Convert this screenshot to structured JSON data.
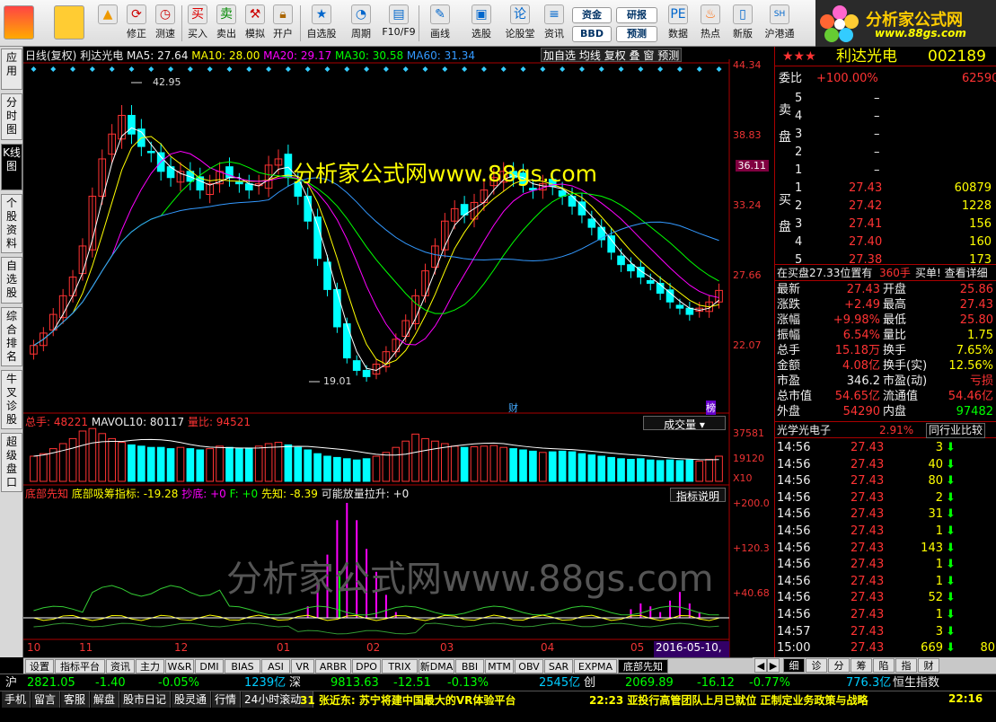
{
  "toolbar": {
    "items": [
      "修正",
      "测速",
      "买入",
      "卖出",
      "模拟",
      "开户",
      "自选股",
      "周期",
      "F10/F9",
      "画线",
      "选股",
      "论股堂",
      "资讯",
      "数据",
      "热点",
      "新版",
      "沪港通"
    ],
    "fund_label": "资金",
    "bbd_label": "BBD",
    "research_label": "研报",
    "forecast_label": "预测"
  },
  "logo": {
    "title": "分析家公式网",
    "url": "www.88gs.com"
  },
  "left_tabs": [
    "应用",
    "分时图",
    "K线图",
    "个股资料",
    "自选股",
    "综合排名",
    "牛叉诊股",
    "超级盘口"
  ],
  "chart_header": {
    "period": "日线(复权)",
    "stock": "利达光电",
    "ma5": "MA5: 27.64",
    "ma10": "MA10: 28.00",
    "ma20": "MA20: 29.17",
    "ma30": "MA30: 30.58",
    "ma60": "MA60: 31.34",
    "buttons": [
      "加自选",
      "均线",
      "复权",
      "叠",
      "窗",
      "预测"
    ]
  },
  "price_axis": [
    "44.34",
    "38.83",
    "33.24",
    "27.66",
    "22.07"
  ],
  "current_price_tag": "36.11",
  "annotations": {
    "high": "42.95",
    "low": "19.01",
    "cai": "财",
    "bang": "榜"
  },
  "watermark_top": "分析家公式网www.88gs.com",
  "watermark_bottom": "分析家公式网www.88gs.com",
  "volume_header": {
    "total": "总手: 48221",
    "mavol": "MAVOL10: 80117",
    "ratio": "量比: 94521",
    "dropdown": "成交量"
  },
  "volume_axis": [
    "37581",
    "19120",
    "X10"
  ],
  "indicator_header": {
    "name": "底部先知",
    "val1": "底部吸筹指标: -19.28",
    "val2": "抄底: +0",
    "val3": "F: +0",
    "val4": "先知: -8.39",
    "val5": "可能放量拉升: +0",
    "help": "指标说明"
  },
  "indicator_axis": [
    "+200.0",
    "+120.3",
    "+40.68"
  ],
  "x_axis": [
    "10",
    "11",
    "12",
    "01",
    "02",
    "03",
    "04",
    "05"
  ],
  "cursor_date": "2016-05-10,二",
  "right_panel": {
    "rating": "★★★",
    "name": "利达光电",
    "code": "002189",
    "webi_label": "委比",
    "webi_val": "+100.00%",
    "webi_diff": "62590",
    "sell_label": "卖盘",
    "buy_label": "买盘",
    "sell": [
      {
        "n": "5",
        "p": "–",
        "v": ""
      },
      {
        "n": "4",
        "p": "–",
        "v": ""
      },
      {
        "n": "3",
        "p": "–",
        "v": ""
      },
      {
        "n": "2",
        "p": "–",
        "v": ""
      },
      {
        "n": "1",
        "p": "–",
        "v": ""
      }
    ],
    "buy": [
      {
        "n": "1",
        "p": "27.43",
        "v": "60879"
      },
      {
        "n": "2",
        "p": "27.42",
        "v": "1228"
      },
      {
        "n": "3",
        "p": "27.41",
        "v": "156"
      },
      {
        "n": "4",
        "p": "27.40",
        "v": "160"
      },
      {
        "n": "5",
        "p": "27.38",
        "v": "173"
      }
    ],
    "notice": "在买盘27.33位置有",
    "notice2": "360手",
    "notice3": "买单! 查看详细",
    "quote": [
      {
        "l": "最新",
        "v": "27.43",
        "l2": "开盘",
        "v2": "25.86"
      },
      {
        "l": "涨跌",
        "v": "+2.49",
        "l2": "最高",
        "v2": "27.43"
      },
      {
        "l": "涨幅",
        "v": "+9.98%",
        "l2": "最低",
        "v2": "25.80"
      },
      {
        "l": "振幅",
        "v": "6.54%",
        "l2": "量比",
        "v2": "1.75"
      },
      {
        "l": "总手",
        "v": "15.18万",
        "l2": "换手",
        "v2": "7.65%"
      },
      {
        "l": "金额",
        "v": "4.08亿",
        "l2": "换手(实)",
        "v2": "12.56%"
      },
      {
        "l": "市盈",
        "v": "346.2",
        "l2": "市盈(动)",
        "v2": "亏损"
      },
      {
        "l": "总市值",
        "v": "54.65亿",
        "l2": "流通值",
        "v2": "54.46亿"
      },
      {
        "l": "外盘",
        "v": "54290",
        "l2": "内盘",
        "v2": "97482"
      }
    ],
    "sector": "光学光电子",
    "sector_pct": "2.91%",
    "compare": "同行业比较",
    "ticks": [
      {
        "t": "14:56",
        "p": "27.43",
        "v": "3"
      },
      {
        "t": "14:56",
        "p": "27.43",
        "v": "40"
      },
      {
        "t": "14:56",
        "p": "27.43",
        "v": "80"
      },
      {
        "t": "14:56",
        "p": "27.43",
        "v": "2"
      },
      {
        "t": "14:56",
        "p": "27.43",
        "v": "31"
      },
      {
        "t": "14:56",
        "p": "27.43",
        "v": "1"
      },
      {
        "t": "14:56",
        "p": "27.43",
        "v": "143"
      },
      {
        "t": "14:56",
        "p": "27.43",
        "v": "1"
      },
      {
        "t": "14:56",
        "p": "27.43",
        "v": "1"
      },
      {
        "t": "14:56",
        "p": "27.43",
        "v": "52"
      },
      {
        "t": "14:56",
        "p": "27.43",
        "v": "1"
      },
      {
        "t": "14:57",
        "p": "27.43",
        "v": "3"
      },
      {
        "t": "15:00",
        "p": "27.43",
        "v": "669"
      }
    ],
    "last_extra": "80",
    "panel_tabs": [
      "细",
      "诊",
      "分",
      "筹",
      "陷",
      "指",
      "财"
    ]
  },
  "bottom_tabs": [
    "设置",
    "指标平台",
    "资讯",
    "主力",
    "W&R",
    "DMI",
    "BIAS",
    "ASI",
    "VR",
    "ARBR",
    "DPO",
    "TRIX",
    "新DMA",
    "BBI",
    "MTM",
    "OBV",
    "SAR",
    "EXPMA",
    "底部先知"
  ],
  "index_bar": {
    "sh_label": "沪",
    "sh": "2821.05",
    "sh_chg": "-1.40",
    "sh_pct": "-0.05%",
    "sh_amt": "1239亿",
    "sz_label": "深",
    "sz": "9813.63",
    "sz_chg": "-12.51",
    "sz_pct": "-0.13%",
    "sz_amt": "2545亿",
    "cy_label": "创",
    "cy": "2069.89",
    "cy_chg": "-16.12",
    "cy_pct": "-0.77%",
    "cy_amt": "776.3亿",
    "hs_label": "恒生指数"
  },
  "status_bar": {
    "buttons": [
      "手机",
      "留言",
      "客服",
      "解盘",
      "股市日记",
      "股灵通",
      "行情",
      "24小时滚动"
    ],
    "news1": "31 张近东: 苏宁将建中国最大的VR体验平台",
    "news2": "22:23 亚投行高管团队上月已就位 正制定业务政策与战略",
    "time": "22:16"
  },
  "colors": {
    "up": "#ff3333",
    "down": "#00ffff",
    "ma5": "#ffffff",
    "ma10": "#ffff00",
    "ma20": "#ff00ff",
    "ma30": "#00ff00",
    "ma60": "#3399ff"
  },
  "chart_data": {
    "type": "candlestick",
    "ylim": [
      19.01,
      44.34
    ],
    "months": [
      "10",
      "11",
      "12",
      "01",
      "02",
      "03",
      "04",
      "05"
    ],
    "close": [
      23,
      24,
      25.5,
      27,
      28.5,
      31,
      35,
      38,
      40,
      41.5,
      40,
      39,
      38.5,
      37,
      36.5,
      37,
      36.2,
      35.5,
      36,
      37,
      36.5,
      36,
      35.5,
      36,
      37.5,
      38,
      36.5,
      35,
      33,
      30,
      27.5,
      24.5,
      22,
      21,
      20.5,
      21.5,
      22.5,
      23.5,
      25,
      27,
      29,
      31,
      33,
      34,
      33.5,
      34.5,
      35.5,
      36.5,
      37,
      36.5,
      36,
      35.5,
      36,
      35.8,
      35,
      34.2,
      33.5,
      32.5,
      31.5,
      30.5,
      29.5,
      29,
      28.5,
      28,
      27.2,
      26.5,
      26,
      25.5,
      26,
      26.5,
      27.43
    ],
    "volume": [
      20000,
      22000,
      26000,
      30000,
      34000,
      40000,
      42000,
      38000,
      34000,
      31000,
      29000,
      28000,
      27000,
      27000,
      26000,
      27000,
      26000,
      25000,
      26000,
      28000,
      27000,
      26000,
      26500,
      28000,
      30000,
      31000,
      29000,
      27000,
      25000,
      22000,
      20000,
      19000,
      18000,
      17000,
      18000,
      20000,
      23000,
      27000,
      32000,
      37581,
      34000,
      32000,
      30000,
      28000,
      27000,
      27500,
      28000,
      28500,
      27000,
      26000,
      25000,
      24000,
      23000,
      23500,
      24000,
      23500,
      22000,
      21000,
      20000,
      19000,
      18000,
      17500,
      18000,
      17000,
      16500,
      17000,
      16500,
      17000,
      16000,
      17500,
      20000
    ],
    "indicator_peaks": [
      0,
      0,
      0,
      0,
      0,
      0,
      0,
      0,
      0,
      0,
      0,
      0,
      0,
      0,
      0,
      0,
      0,
      0,
      0,
      0,
      0,
      0,
      0,
      0,
      0,
      0,
      0,
      0,
      20,
      60,
      110,
      170,
      200,
      170,
      120,
      80,
      40,
      10,
      0,
      0,
      0,
      0,
      0,
      0,
      0,
      0,
      0,
      0,
      0,
      0,
      0,
      0,
      0,
      0,
      0,
      0,
      0,
      0,
      0,
      0,
      0,
      15,
      25,
      20,
      10,
      30,
      45,
      25,
      10,
      0,
      0
    ]
  }
}
